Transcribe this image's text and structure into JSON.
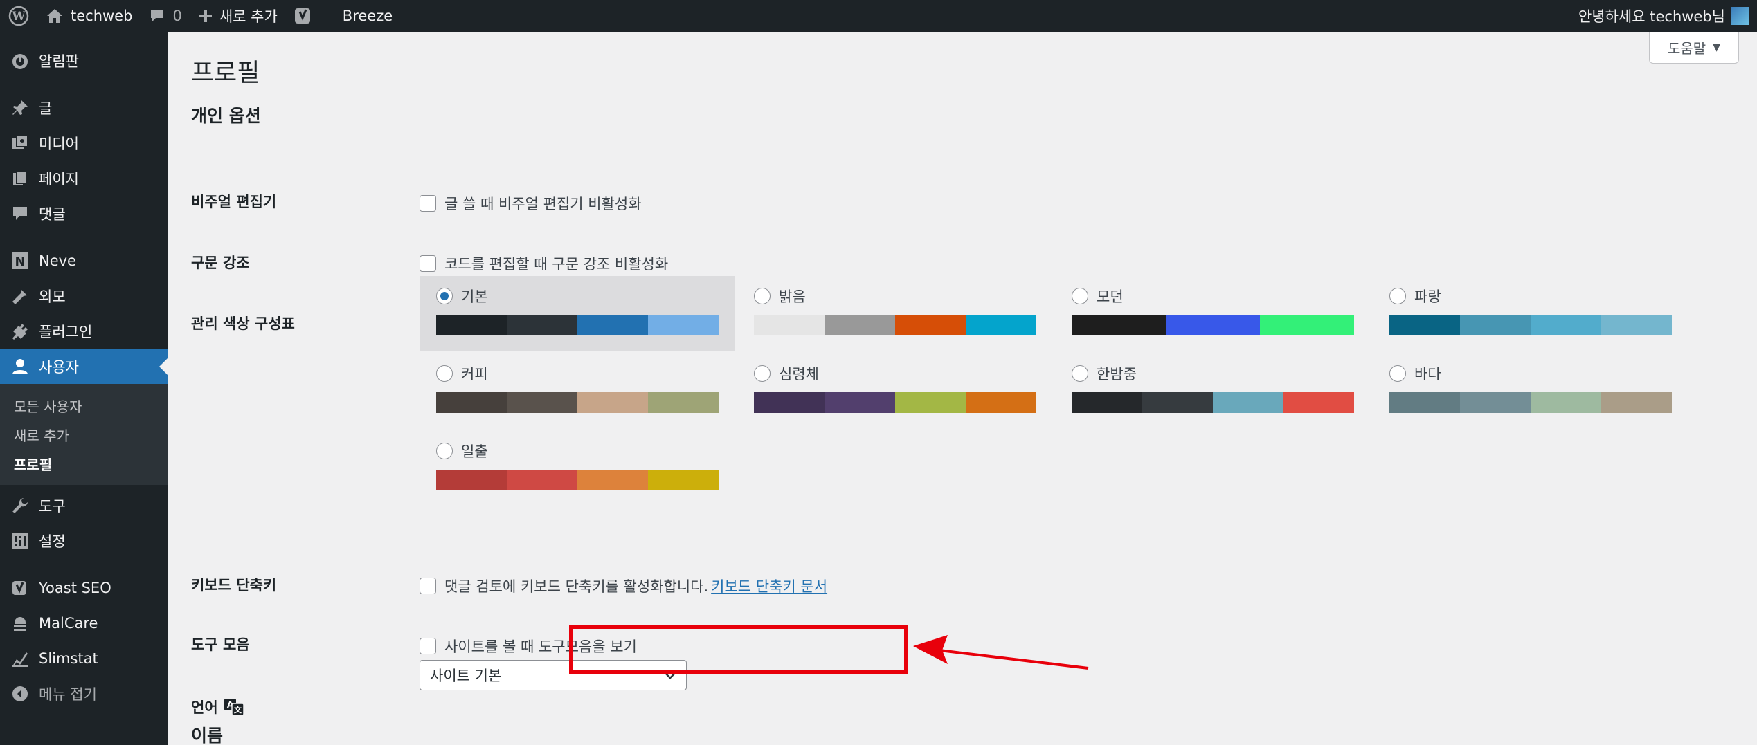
{
  "adminbar": {
    "site_name": "techweb",
    "comments_count": "0",
    "new_label": "새로 추가",
    "breeze_label": "Breeze",
    "greeting": "안녕하세요 techweb님"
  },
  "sidebar": {
    "items": [
      {
        "label": "알림판",
        "icon": "dashboard-icon"
      },
      {
        "label": "글",
        "icon": "pin-icon"
      },
      {
        "label": "미디어",
        "icon": "media-icon"
      },
      {
        "label": "페이지",
        "icon": "page-icon"
      },
      {
        "label": "댓글",
        "icon": "comment-icon"
      },
      {
        "label": "Neve",
        "icon": "neve-icon"
      },
      {
        "label": "외모",
        "icon": "appearance-icon"
      },
      {
        "label": "플러그인",
        "icon": "plugin-icon"
      },
      {
        "label": "사용자",
        "icon": "user-icon"
      },
      {
        "label": "도구",
        "icon": "wrench-icon"
      },
      {
        "label": "설정",
        "icon": "settings-icon"
      },
      {
        "label": "Yoast SEO",
        "icon": "yoast-icon"
      },
      {
        "label": "MalCare",
        "icon": "malcare-icon"
      },
      {
        "label": "Slimstat",
        "icon": "slimstat-icon"
      },
      {
        "label": "메뉴 접기",
        "icon": "collapse-icon"
      }
    ],
    "submenu": [
      "모든 사용자",
      "새로 추가",
      "프로필"
    ]
  },
  "help": {
    "label": "도움말"
  },
  "page": {
    "title": "프로필",
    "section_personal": "개인 옵션",
    "section_name": "이름"
  },
  "options": {
    "visual_editor": {
      "label": "비주얼 편집기",
      "text": "글 쓸 때 비주얼 편집기 비활성화"
    },
    "syntax": {
      "label": "구문 강조",
      "text": "코드를 편집할 때 구문 강조 비활성화"
    },
    "color_scheme_label": "관리 색상 구성표",
    "keyboard": {
      "label": "키보드 단축키",
      "text": "댓글 검토에 키보드 단축키를 활성화합니다.",
      "link": "키보드 단축키 문서"
    },
    "toolbar": {
      "label": "도구 모음",
      "text": "사이트를 볼 때 도구모음을 보기"
    },
    "language": {
      "label": "언어",
      "value": "사이트 기본"
    }
  },
  "color_schemes": [
    {
      "name": "기본",
      "selected": true,
      "colors": [
        "#1d2327",
        "#2c3338",
        "#2271b1",
        "#72aee6"
      ]
    },
    {
      "name": "밝음",
      "selected": false,
      "colors": [
        "#e5e5e5",
        "#999999",
        "#d64e07",
        "#04a4cc"
      ]
    },
    {
      "name": "모던",
      "selected": false,
      "colors": [
        "#1e1e1e",
        "#3858e9",
        "#33f078"
      ]
    },
    {
      "name": "파랑",
      "selected": false,
      "colors": [
        "#096484",
        "#4796b3",
        "#52accc",
        "#74b6ce"
      ]
    },
    {
      "name": "커피",
      "selected": false,
      "colors": [
        "#46403c",
        "#59524c",
        "#c7a589",
        "#9ea476"
      ]
    },
    {
      "name": "심령체",
      "selected": false,
      "colors": [
        "#413256",
        "#523f6d",
        "#a3b745",
        "#d46f15"
      ]
    },
    {
      "name": "한밤중",
      "selected": false,
      "colors": [
        "#25282b",
        "#363b3f",
        "#69a8bb",
        "#e14d43"
      ]
    },
    {
      "name": "바다",
      "selected": false,
      "colors": [
        "#627c83",
        "#738e96",
        "#9ebaa0",
        "#aa9d88"
      ]
    },
    {
      "name": "일출",
      "selected": false,
      "colors": [
        "#b43c38",
        "#cf4944",
        "#dd823b",
        "#ccaf0b"
      ]
    }
  ],
  "colors": {
    "accent": "#2271b1",
    "admin_bar": "#1d2327",
    "annotation": "#e8000b"
  }
}
